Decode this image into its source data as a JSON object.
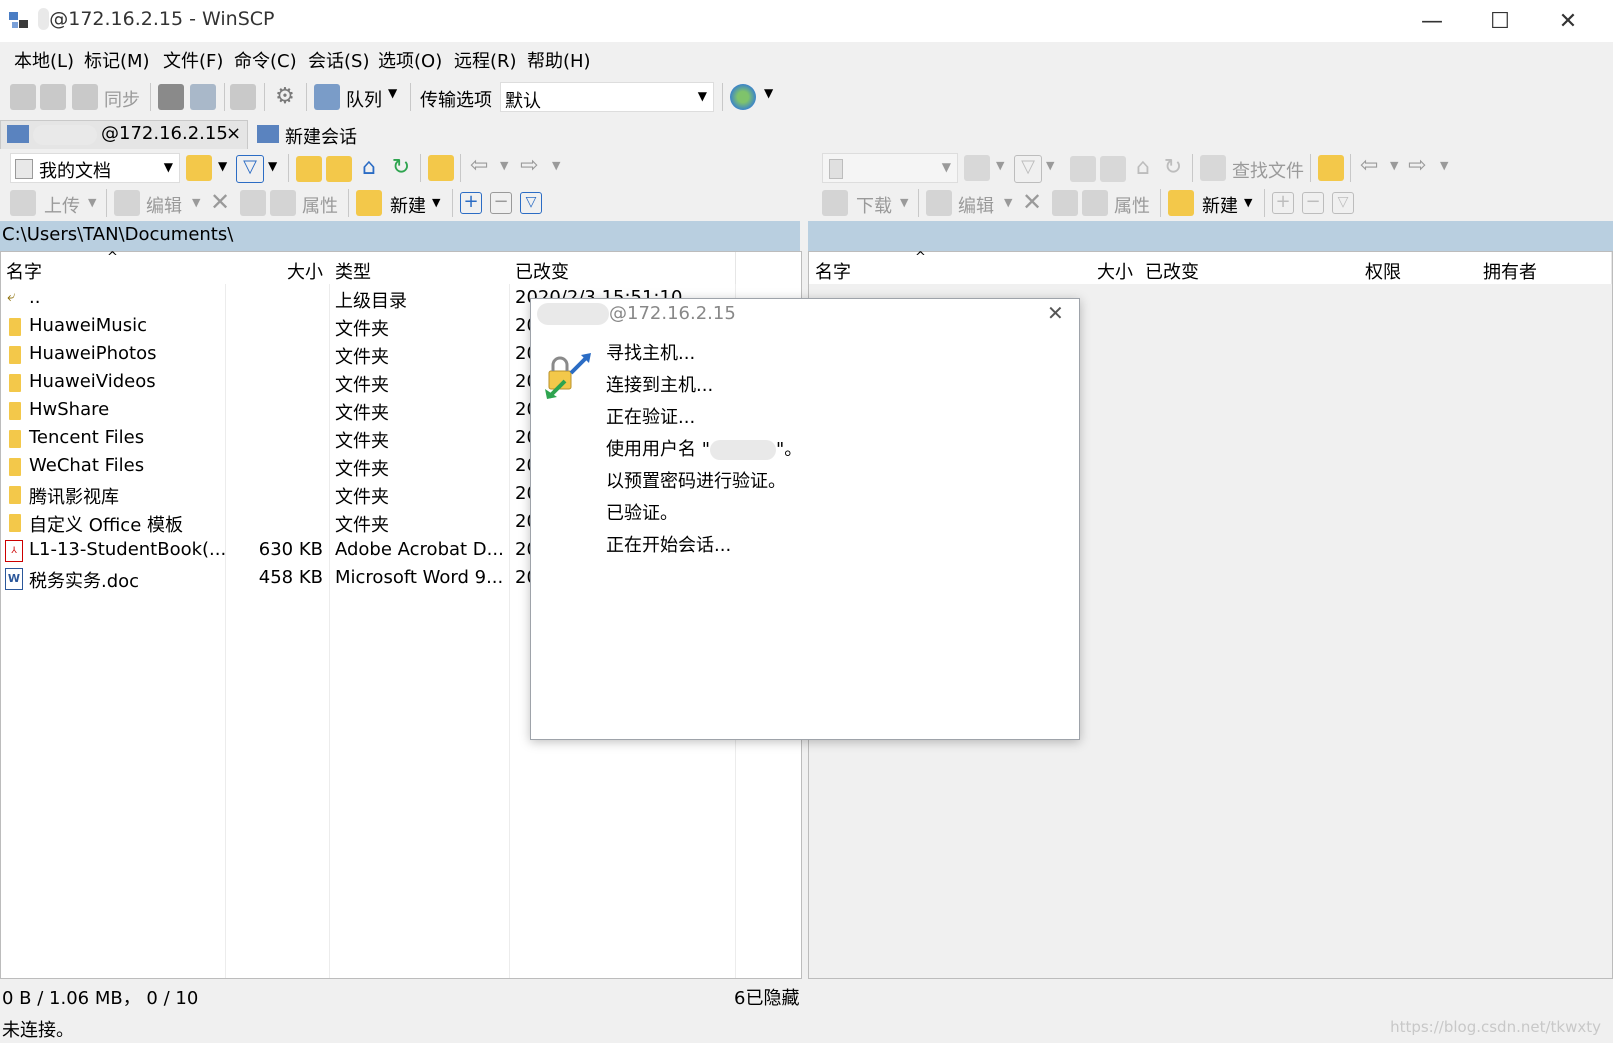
{
  "window": {
    "title_host": "@172.16.2.15 - WinSCP",
    "title_hidden_prefix": "      v",
    "buttons": {
      "minimize": "—",
      "maximize": "☐",
      "close": "✕"
    }
  },
  "menu": [
    "本地(L)",
    "标记(M)",
    "文件(F)",
    "命令(C)",
    "会话(S)",
    "选项(O)",
    "远程(R)",
    "帮助(H)"
  ],
  "toolbar": {
    "sync_label": "同步",
    "queue_label": "队列",
    "transfer_options_label": "传输选项",
    "transfer_profile_value": "默认"
  },
  "tabs": [
    {
      "label": "@172.16.2.15",
      "close": "×"
    },
    {
      "label": "新建会话"
    }
  ],
  "left": {
    "location_value": "我的文档",
    "actions": {
      "upload": "上传",
      "edit": "编辑",
      "properties": "属性",
      "new": "新建"
    },
    "path": "C:\\Users\\TAN\\Documents\\",
    "columns": [
      "名字",
      "大小",
      "类型",
      "已改变"
    ],
    "rows": [
      {
        "name": "..",
        "size": "",
        "type": "上级目录",
        "changed": "2020/2/3 15:51:10",
        "icon": "parent-dir"
      },
      {
        "name": "HuaweiMusic",
        "size": "",
        "type": "文件夹",
        "changed": "20",
        "icon": "folder"
      },
      {
        "name": "HuaweiPhotos",
        "size": "",
        "type": "文件夹",
        "changed": "20",
        "icon": "folder"
      },
      {
        "name": "HuaweiVideos",
        "size": "",
        "type": "文件夹",
        "changed": "20",
        "icon": "folder"
      },
      {
        "name": "HwShare",
        "size": "",
        "type": "文件夹",
        "changed": "20",
        "icon": "folder"
      },
      {
        "name": "Tencent Files",
        "size": "",
        "type": "文件夹",
        "changed": "20",
        "icon": "folder"
      },
      {
        "name": "WeChat Files",
        "size": "",
        "type": "文件夹",
        "changed": "20",
        "icon": "folder"
      },
      {
        "name": "腾讯影视库",
        "size": "",
        "type": "文件夹",
        "changed": "20",
        "icon": "folder"
      },
      {
        "name": "自定义 Office 模板",
        "size": "",
        "type": "文件夹",
        "changed": "20",
        "icon": "folder"
      },
      {
        "name": "L1-13-StudentBook(...",
        "size": "630 KB",
        "type": "Adobe Acrobat D...",
        "changed": "20",
        "icon": "pdf"
      },
      {
        "name": "税务实务.doc",
        "size": "458 KB",
        "type": "Microsoft Word 9...",
        "changed": "20",
        "icon": "word"
      }
    ]
  },
  "right": {
    "find_files": "查找文件",
    "actions": {
      "download": "下载",
      "edit": "编辑",
      "properties": "属性",
      "new": "新建"
    },
    "columns": [
      "名字",
      "大小",
      "已改变",
      "权限",
      "拥有者"
    ]
  },
  "dialog": {
    "title": "@172.16.2.15",
    "close": "✕",
    "lines": [
      "寻找主机...",
      "连接到主机...",
      "正在验证...",
      "使用用户名 \"",
      "以预置密码进行验证。",
      "已验证。",
      "正在开始会话..."
    ],
    "username_suffix": "\"。"
  },
  "status": {
    "left_summary": "0 B / 1.06 MB，  0 / 10",
    "hidden": "6已隐藏",
    "connection": "未连接。",
    "watermark": "https://blog.csdn.net/tkwxty"
  },
  "colors": {
    "path_bar": "#b9cfe0",
    "folder": "#f3c84a",
    "accent_green": "#2ea44f",
    "accent_blue": "#2b6cc4"
  }
}
